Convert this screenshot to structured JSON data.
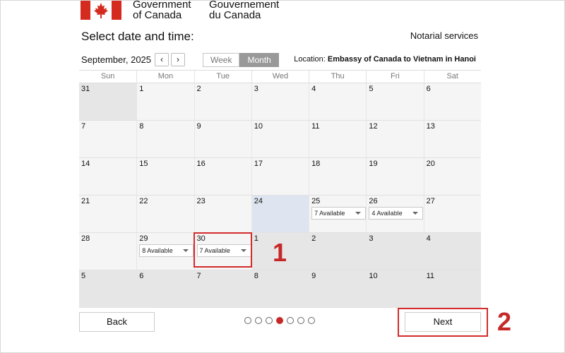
{
  "header": {
    "gov_en_line1": "Government",
    "gov_en_line2": "of Canada",
    "gov_fr_line1": "Gouvernement",
    "gov_fr_line2": "du Canada",
    "flag_color": "#d52b1e"
  },
  "page_title": "Select date and time:",
  "service": "Notarial services",
  "toolbar": {
    "month_label": "September, 2025",
    "prev_label": "‹",
    "next_label": "›",
    "view_week": "Week",
    "view_month": "Month",
    "location_label": "Location:",
    "location_value": "Embassy of Canada to Vietnam in Hanoi"
  },
  "calendar": {
    "day_names": [
      "Sun",
      "Mon",
      "Tue",
      "Wed",
      "Thu",
      "Fri",
      "Sat"
    ],
    "weeks": [
      [
        {
          "day": "31",
          "state": "muted"
        },
        {
          "day": "1"
        },
        {
          "day": "2"
        },
        {
          "day": "3"
        },
        {
          "day": "4"
        },
        {
          "day": "5"
        },
        {
          "day": "6"
        }
      ],
      [
        {
          "day": "7"
        },
        {
          "day": "8"
        },
        {
          "day": "9"
        },
        {
          "day": "10"
        },
        {
          "day": "11"
        },
        {
          "day": "12"
        },
        {
          "day": "13"
        }
      ],
      [
        {
          "day": "14"
        },
        {
          "day": "15"
        },
        {
          "day": "16"
        },
        {
          "day": "17"
        },
        {
          "day": "18"
        },
        {
          "day": "19"
        },
        {
          "day": "20"
        }
      ],
      [
        {
          "day": "21"
        },
        {
          "day": "22"
        },
        {
          "day": "23"
        },
        {
          "day": "24",
          "state": "today"
        },
        {
          "day": "25",
          "avail": "7 Available"
        },
        {
          "day": "26",
          "avail": "4 Available"
        },
        {
          "day": "27"
        }
      ],
      [
        {
          "day": "28"
        },
        {
          "day": "29",
          "avail": "8 Available"
        },
        {
          "day": "30",
          "avail": "7 Available"
        },
        {
          "day": "1",
          "state": "muted"
        },
        {
          "day": "2",
          "state": "muted"
        },
        {
          "day": "3",
          "state": "muted"
        },
        {
          "day": "4",
          "state": "muted"
        }
      ],
      [
        {
          "day": "5",
          "state": "muted"
        },
        {
          "day": "6",
          "state": "muted"
        },
        {
          "day": "7",
          "state": "muted"
        },
        {
          "day": "8",
          "state": "muted"
        },
        {
          "day": "9",
          "state": "muted"
        },
        {
          "day": "10",
          "state": "muted"
        },
        {
          "day": "11",
          "state": "muted"
        }
      ]
    ]
  },
  "callouts": {
    "one": "1",
    "two": "2",
    "color": "#c62828"
  },
  "footer": {
    "back_label": "Back",
    "next_label": "Next",
    "steps_total": 7,
    "steps_current": 4
  }
}
